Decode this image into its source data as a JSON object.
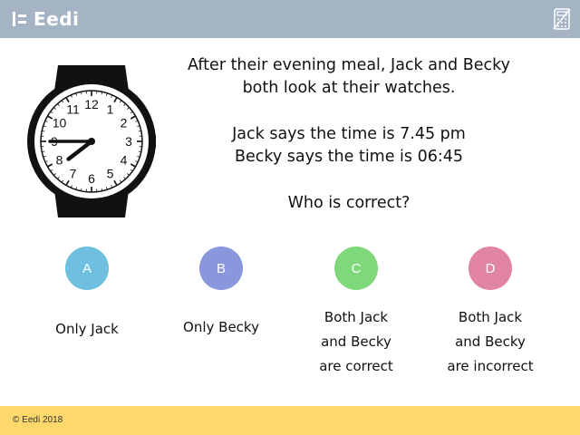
{
  "header": {
    "brand": "Eedi",
    "logo_icon": "eedi-logo-icon",
    "calculator_icon": "calculator-crossed-icon"
  },
  "question": {
    "line1": "After their evening meal, Jack and Becky",
    "line2": "both look at their watches.",
    "line3": "Jack says the time is 7.45 pm",
    "line4": "Becky says the time is 06:45",
    "line5": "Who is correct?"
  },
  "watch": {
    "numbers": [
      "12",
      "1",
      "2",
      "3",
      "4",
      "5",
      "6",
      "7",
      "8",
      "9",
      "10",
      "11"
    ],
    "hour_hand_hours": 7.75,
    "minute_hand_minutes": 45
  },
  "options": [
    {
      "letter": "A",
      "color": "#6fc0e0",
      "lines": [
        "Only Jack"
      ]
    },
    {
      "letter": "B",
      "color": "#8b97dc",
      "lines": [
        "Only Becky"
      ]
    },
    {
      "letter": "C",
      "color": "#7fd87a",
      "lines": [
        "Both Jack",
        "and Becky",
        "are correct"
      ]
    },
    {
      "letter": "D",
      "color": "#e184a4",
      "lines": [
        "Both Jack",
        "and Becky",
        "are incorrect"
      ]
    }
  ],
  "footer": {
    "copyright": "© Eedi 2018"
  }
}
